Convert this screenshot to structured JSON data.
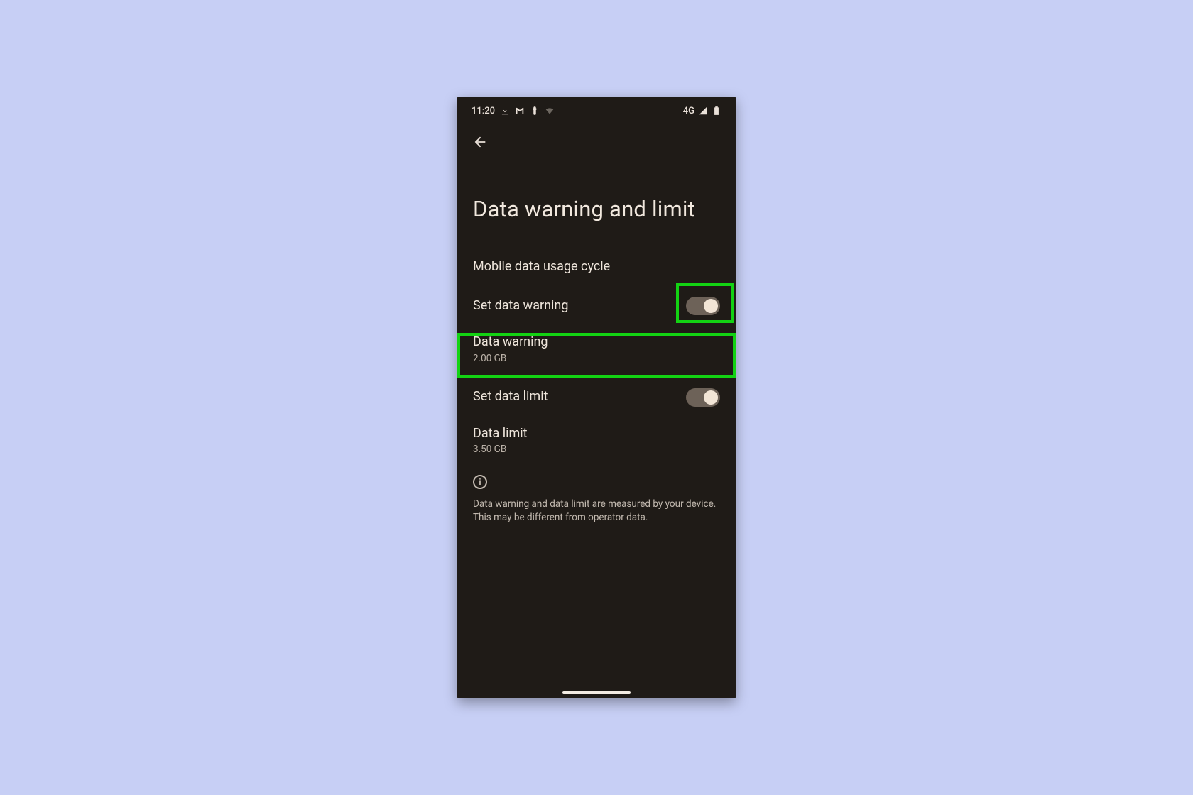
{
  "status": {
    "time": "11:20",
    "network_label": "4G"
  },
  "page": {
    "title": "Data warning and limit"
  },
  "rows": {
    "usage_cycle": {
      "label": "Mobile data usage cycle"
    },
    "set_warning": {
      "label": "Set data warning",
      "on": true
    },
    "data_warning": {
      "label": "Data warning",
      "value": "2.00 GB"
    },
    "set_limit": {
      "label": "Set data limit",
      "on": true
    },
    "data_limit": {
      "label": "Data limit",
      "value": "3.50 GB"
    }
  },
  "footer": {
    "note": "Data warning and data limit are measured by your device. This may be different from operator data."
  },
  "annotations": {
    "highlight_toggle": true,
    "highlight_data_warning_row": true
  }
}
